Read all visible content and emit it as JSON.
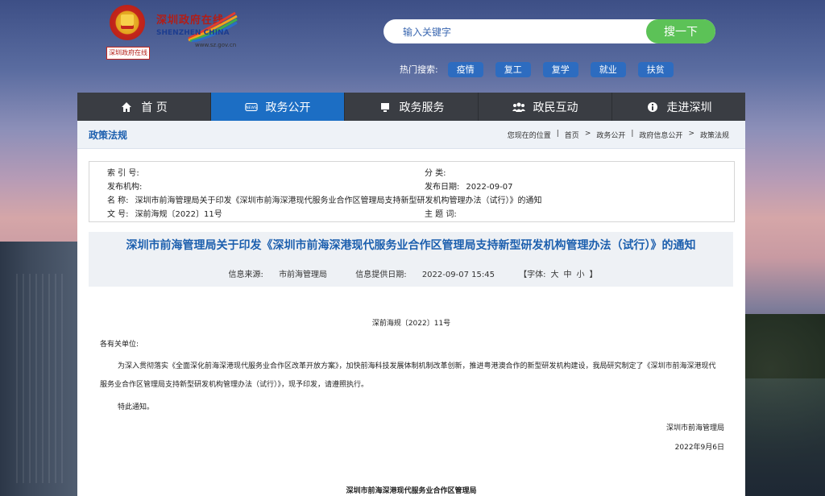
{
  "header": {
    "emblem_tag": "深圳政府在线",
    "brand_cn": "深圳政府在线",
    "brand_en": "SHENZHEN CHINA",
    "brand_url": "www.sz.gov.cn"
  },
  "search": {
    "placeholder": "输入关键字",
    "button": "搜一下"
  },
  "hot": {
    "label": "热门搜索:",
    "tags": [
      "疫情",
      "复工",
      "复学",
      "就业",
      "扶贫"
    ]
  },
  "nav": {
    "items": [
      {
        "label": "首 页",
        "icon": "home-icon"
      },
      {
        "label": "政务公开",
        "icon": "news-icon"
      },
      {
        "label": "政务服务",
        "icon": "monitor-icon"
      },
      {
        "label": "政民互动",
        "icon": "people-icon"
      },
      {
        "label": "走进深圳",
        "icon": "info-icon"
      }
    ],
    "active_index": 1
  },
  "section": {
    "title": "政策法规"
  },
  "breadcrumb": {
    "prefix": "您现在的位置",
    "items": [
      "首页",
      "政务公开",
      "政府信息公开",
      "政策法规"
    ]
  },
  "meta": {
    "index_label": "索 引 号:",
    "index_value": "",
    "category_label": "分 类:",
    "category_value": "",
    "publisher_label": "发布机构:",
    "publisher_value": "",
    "date_label": "发布日期:",
    "date_value": "2022-09-07",
    "name_label": "名 称:",
    "name_value": "深圳市前海管理局关于印发《深圳市前海深港现代服务业合作区管理局支持新型研发机构管理办法（试行）》的通知",
    "docno_label": "文 号:",
    "docno_value": "深前海规〔2022〕11号",
    "subject_label": "主 题 词:",
    "subject_value": ""
  },
  "doc": {
    "title": "深圳市前海管理局关于印发《深圳市前海深港现代服务业合作区管理局支持新型研发机构管理办法（试行）》的通知",
    "source_label": "信息来源:",
    "source_value": "市前海管理局",
    "provided_label": "信息提供日期:",
    "provided_value": "2022-09-07 15:45",
    "font_label": "【字体:",
    "font_large": "大",
    "font_medium": "中",
    "font_small": "小",
    "font_close": "】",
    "number": "深前海规〔2022〕11号",
    "salutation": "各有关单位:",
    "paragraph": "为深入贯彻落实《全面深化前海深港现代服务业合作区改革开放方案》，加快前海科技发展体制机制改革创新，推进粤港澳合作的新型研发机构建设，我局研究制定了《深圳市前海深港现代服务业合作区管理局支持新型研发机构管理办法（试行）》，现予印发，请遵照执行。",
    "closing": "特此通知。",
    "signature": "深圳市前海管理局",
    "sign_date": "2022年9月6日",
    "footer_org": "深圳市前海深港现代服务业合作区管理局"
  },
  "colors": {
    "nav_active": "#1c6ec4",
    "nav_bg": "#3a3d43",
    "search_button": "#5cc257",
    "hot_tag": "#2d6cc0",
    "title_blue": "#1c5fae"
  }
}
